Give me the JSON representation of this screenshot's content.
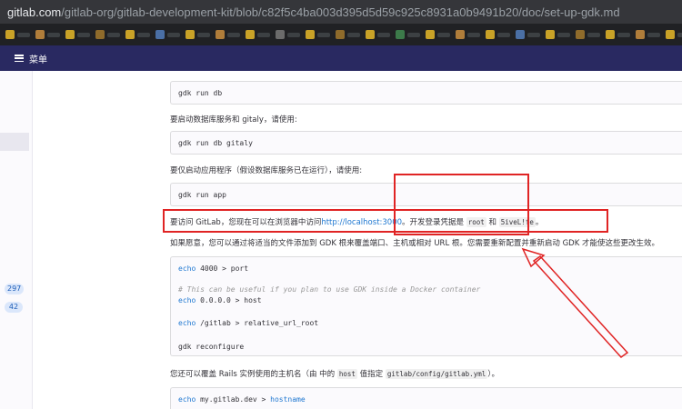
{
  "browser": {
    "url_domain": "gitlab.com",
    "url_path": "/gitlab-org/gitlab-development-kit/blob/c82f5c4ba003d395d5d59c925c8931a0b9491b20/doc/set-up-gdk.md"
  },
  "nav": {
    "menu_label": "菜单"
  },
  "sidebar": {
    "badges": [
      "297",
      "42"
    ]
  },
  "content": {
    "code1": "gdk run db",
    "para1": "要启动数据库服务和 gitaly，请使用:",
    "code2": "gdk run db gitaly",
    "para2": "要仅启动应用程序（假设数据库服务已在运行），请使用:",
    "code3": "gdk run app",
    "para3_prefix": "要访问 GitLab，您现在可以在浏览器中访问",
    "para3_link": "http://localhost:3000",
    "para3_middle": "。开发登录凭据是",
    "para3_code1": "root",
    "para3_and": "和",
    "para3_code2": "5iveL!fe",
    "para3_suffix": "。",
    "para4": "如果愿意，您可以通过将适当的文件添加到 GDK 根来覆盖端口、主机或相对 URL 根。您需要重新配置并重新启动 GDK 才能使这些更改生效。",
    "code4": {
      "l1_kw": "echo",
      "l1_rest": " 4000 > port",
      "l2": "# This can be useful if you plan to use GDK inside a Docker container",
      "l3_kw": "echo",
      "l3_rest": " 0.0.0.0 > host",
      "l4_kw": "echo",
      "l4_rest": " /gitlab > relative_url_root",
      "l5": "gdk reconfigure"
    },
    "para5_prefix": "您还可以覆盖 Rails 实例使用的主机名（由 中的",
    "para5_code1": "host",
    "para5_middle": "值指定",
    "para5_code2": "gitlab/config/gitlab.yml",
    "para5_suffix": "）。",
    "code5_kw": "echo",
    "code5_rest": " my.gitlab.dev > ",
    "code5_tail": "hostname"
  },
  "colors": {
    "annotation": "#e02424",
    "nav_bg": "#292961",
    "link": "#1f78d1"
  }
}
